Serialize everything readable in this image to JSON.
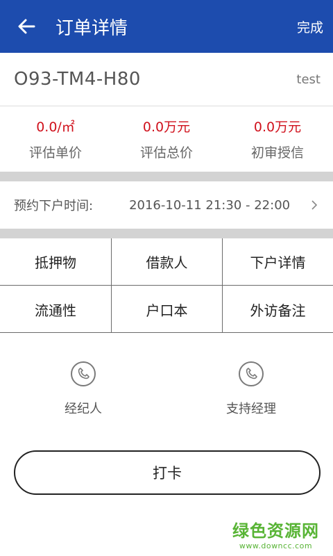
{
  "header": {
    "title": "订单详情",
    "done_label": "完成"
  },
  "order": {
    "number": "O93-TM4-H80",
    "tag": "test"
  },
  "stats": [
    {
      "value": "0.0/㎡",
      "label": "评估单价"
    },
    {
      "value": "0.0万元",
      "label": "评估总价"
    },
    {
      "value": "0.0万元",
      "label": "初审授信"
    }
  ],
  "appointment": {
    "label": "预约下户时间:",
    "value": "2016-10-11 21:30 - 22:00"
  },
  "grid": [
    "抵押物",
    "借款人",
    "下户详情",
    "流通性",
    "户口本",
    "外访备注"
  ],
  "contacts": [
    {
      "label": "经纪人",
      "icon": "phone-icon"
    },
    {
      "label": "支持经理",
      "icon": "phone-icon"
    }
  ],
  "checkin_label": "打卡",
  "watermark": {
    "main": "绿色资源网",
    "sub": "www.downcc.com"
  },
  "colors": {
    "header_bg": "#1d4cae",
    "value_red": "#d0111c",
    "watermark_green": "#58b435"
  }
}
